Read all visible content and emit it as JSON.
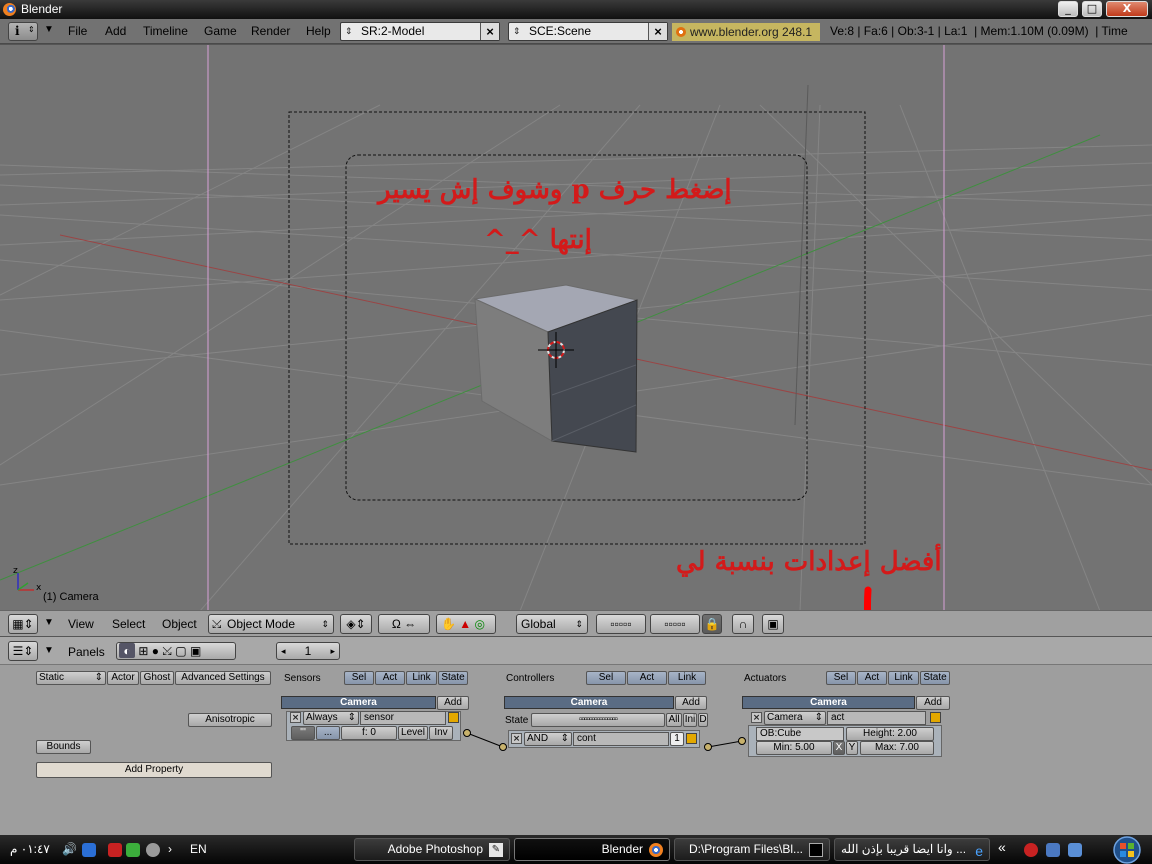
{
  "window": {
    "title": "Blender",
    "minimize": "_",
    "maximize": "□",
    "close": "X"
  },
  "info_header": {
    "menus": [
      "File",
      "Add",
      "Timeline",
      "Game",
      "Render",
      "Help"
    ],
    "screen_field": "SR:2-Model",
    "scene_field": "SCE:Scene",
    "website": "www.blender.org 248.1",
    "stats": "Ve:8 | Fa:6 | Ob:3-1 | La:1  | Mem:1.10M (0.09M)  | Time"
  },
  "viewport": {
    "annotation_line1": "إضغط حرف p وشوف إش يسير",
    "annotation_line2": "إنتها ^_^",
    "annotation_settings": "أفضل إعدادات بنسبة لي",
    "object_label": "(1) Camera",
    "axis_x": "x",
    "axis_z": "z"
  },
  "view_header": {
    "menus": [
      "View",
      "Select",
      "Object"
    ],
    "mode": "Object Mode",
    "orientation": "Global"
  },
  "buttons_header": {
    "panels_label": "Panels",
    "frame": "1"
  },
  "logic": {
    "left": {
      "physics_type": "Static",
      "actor": "Actor",
      "ghost": "Ghost",
      "advanced": "Advanced Settings",
      "anisotropic": "Anisotropic",
      "bounds": "Bounds",
      "add_property": "Add Property"
    },
    "sensors": {
      "title": "Sensors",
      "sel": "Sel",
      "act": "Act",
      "link": "Link",
      "state": "State",
      "object_bar": "Camera",
      "add": "Add",
      "type": "Always",
      "name": "sensor",
      "pulse_true": "'''",
      "pulse_false": "...",
      "freq": "f: 0",
      "level": "Level",
      "inv": "Inv"
    },
    "controllers": {
      "title": "Controllers",
      "sel": "Sel",
      "act": "Act",
      "link": "Link",
      "object_bar": "Camera",
      "add": "Add",
      "state_label": "State",
      "all": "All",
      "ini": "Ini",
      "d": "D",
      "type": "AND",
      "name": "cont",
      "priority": "1"
    },
    "actuators": {
      "title": "Actuators",
      "sel": "Sel",
      "act": "Act",
      "link": "Link",
      "state": "State",
      "object_bar": "Camera",
      "add": "Add",
      "type": "Camera",
      "name": "act",
      "ob": "OB:Cube",
      "height": "Height: 2.00",
      "min": "Min: 5.00",
      "x_axis": "X",
      "y_axis": "Y",
      "max": "Max: 7.00"
    }
  },
  "taskbar": {
    "clock": "٠١:٤٧ م",
    "lang": "EN",
    "tasks": [
      "Adobe Photoshop",
      "Blender",
      "D:\\Program Files\\Bl...",
      "وانا ايضا قريبا بإذن الله ..."
    ],
    "chevron": "«"
  },
  "colors": {
    "viewport_bg": "#737373",
    "annotation_red": "#d31a1a",
    "panel_bar": "#5a6c84",
    "website_bg": "#c6b660"
  }
}
